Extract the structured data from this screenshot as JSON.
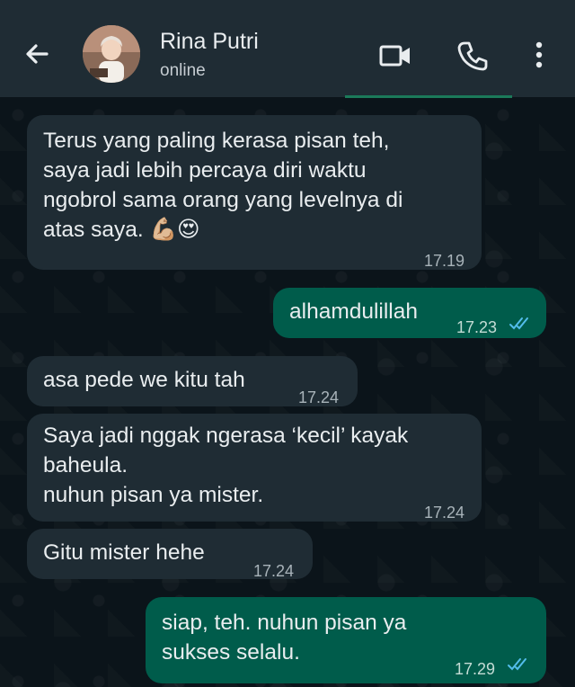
{
  "header": {
    "contact_name": "Rina Putri",
    "status": "online"
  },
  "icons": {
    "back": "arrow-left-icon",
    "video": "video-call-icon",
    "call": "phone-icon",
    "menu": "more-vertical-icon",
    "read_receipt": "double-check-icon"
  },
  "colors": {
    "header_bg": "#1f2c34",
    "chat_bg": "#0b141a",
    "incoming_bubble": "#1f2c34",
    "outgoing_bubble": "#005c4b",
    "read_tick": "#53bdeb"
  },
  "messages": [
    {
      "direction": "in",
      "text": "Terus yang paling kerasa pisan teh,\nsaya jadi lebih percaya diri waktu\nngobrol sama orang yang levelnya di\natas saya. 💪🏼😍",
      "time": "17.19"
    },
    {
      "direction": "out",
      "text": "alhamdulillah",
      "time": "17.23",
      "read": true
    },
    {
      "direction": "in",
      "text": "asa pede we kitu tah",
      "time": "17.24"
    },
    {
      "direction": "in",
      "text": "Saya jadi nggak ngerasa ‘kecil’ kayak\nbaheula.\nnuhun pisan ya mister.",
      "time": "17.24"
    },
    {
      "direction": "in",
      "text": "Gitu mister hehe",
      "time": "17.24"
    },
    {
      "direction": "out",
      "text": "siap, teh. nuhun pisan ya\nsukses selalu.",
      "time": "17.29",
      "read": true
    }
  ]
}
